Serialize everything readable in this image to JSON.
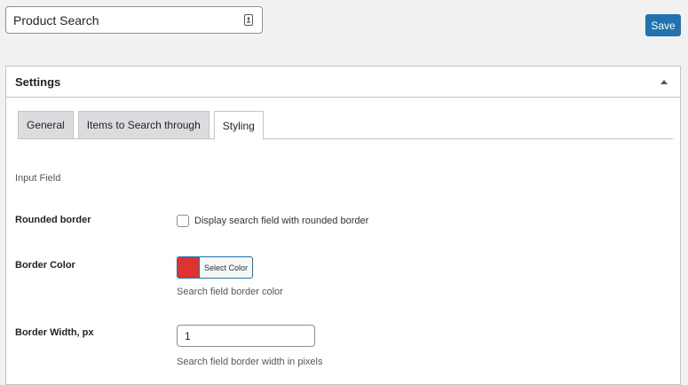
{
  "header": {
    "title_value": "Product Search",
    "title_icon": "key-card-icon",
    "save_label": "Save"
  },
  "settings": {
    "title": "Settings",
    "toggle_icon": "caret-up-icon",
    "tabs": [
      {
        "label": "General",
        "active": false
      },
      {
        "label": "Items to Search through",
        "active": false
      },
      {
        "label": "Styling",
        "active": true
      }
    ],
    "section_title": "Input Field",
    "rows": {
      "rounded_border": {
        "label": "Rounded border",
        "checkbox_label": "Display search field with rounded border",
        "checked": false
      },
      "border_color": {
        "label": "Border Color",
        "button_label": "Select Color",
        "swatch_color": "#dd3333",
        "description": "Search field border color"
      },
      "border_width": {
        "label": "Border Width, px",
        "value": "1",
        "description": "Search field border width in pixels"
      }
    }
  },
  "colors": {
    "accent": "#2271b1",
    "background": "#f1f1f1",
    "tab_inactive": "#dcdcde"
  }
}
